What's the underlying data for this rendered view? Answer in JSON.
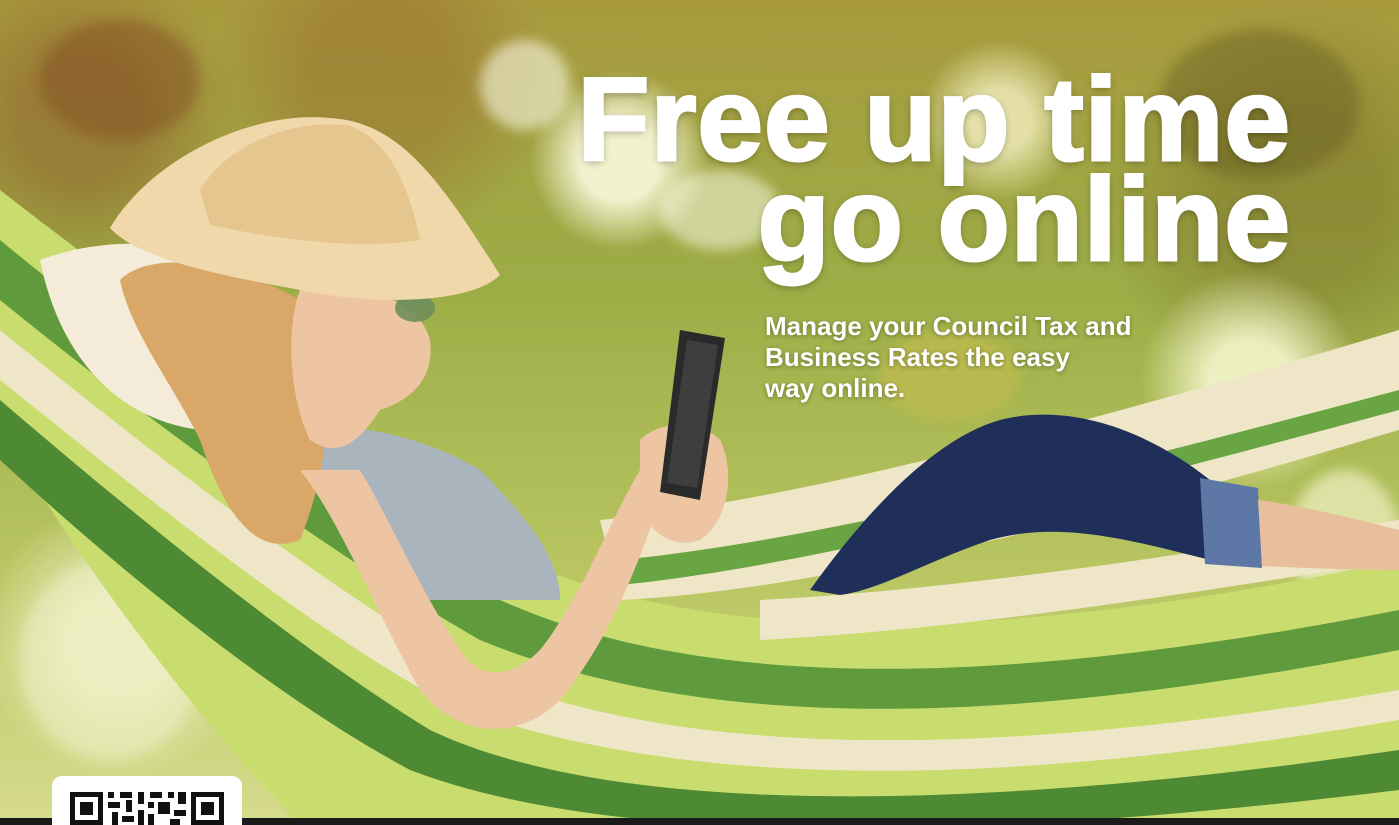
{
  "headline": {
    "line1": "Free up time",
    "line2": "go online"
  },
  "subheading": {
    "line1": "Manage your Council Tax and",
    "line2": "Business Rates the easy",
    "line3": "way online."
  },
  "colors": {
    "headline_text": "#ffffff",
    "bottom_bar": "#1a1a1a",
    "hammock_green": "#5f9a3d",
    "hammock_lime": "#c9dc6e",
    "hammock_cream": "#efe6c8"
  },
  "icons": {
    "qr": "qr-code-icon"
  }
}
